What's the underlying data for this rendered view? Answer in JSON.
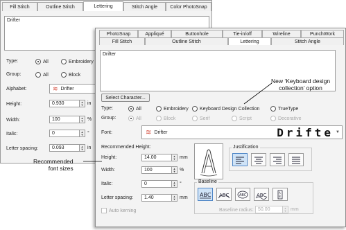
{
  "back_window": {
    "tabs": [
      "Fill Stitch",
      "Outline Stitch",
      "Lettering",
      "Stitch Angle",
      "Color PhotoSnap"
    ],
    "active_tab": "Lettering",
    "text_value": "Drifter",
    "type_label": "Type:",
    "type_options": [
      "All",
      "Embroidery"
    ],
    "group_label": "Group:",
    "group_options": [
      "All",
      "Block"
    ],
    "alphabet_label": "Alphabet:",
    "alphabet_value": "Drifter",
    "height_label": "Height:",
    "height_value": "0.930",
    "height_unit": "in",
    "width_label": "Width:",
    "width_value": "100",
    "width_unit": "%",
    "italic_label": "Italic:",
    "italic_value": "0",
    "italic_unit": "°",
    "spacing_label": "Letter spacing:",
    "spacing_value": "0.093",
    "spacing_unit": "in"
  },
  "front_window": {
    "tabs_row1": [
      "PhotoSnap",
      "Appliqué",
      "Buttonhole",
      "Tie-in/off",
      "Wireline",
      "PunchWork"
    ],
    "tabs_row2": [
      "Fill Stitch",
      "Outline Stitch",
      "Lettering",
      "Stitch Angle"
    ],
    "active_tab": "Lettering",
    "text_value": "Drifter",
    "select_character": "Select Character...",
    "type_label": "Type:",
    "type_options": [
      "All",
      "Embroidery",
      "Keyboard Design Collection",
      "TrueType"
    ],
    "group_label": "Group:",
    "group_options": [
      "All",
      "Block",
      "Serif",
      "Script",
      "Decorative"
    ],
    "font_label": "Font:",
    "font_value": "Drifter",
    "font_preview": "Drifte",
    "recommended_height": "Recommended Height:",
    "height_label": "Height:",
    "height_value": "14.00",
    "height_unit": "mm",
    "width_label": "Width:",
    "width_value": "100",
    "width_unit": "%",
    "italic_label": "Italic:",
    "italic_value": "0",
    "italic_unit": "°",
    "spacing_label": "Letter spacing:",
    "spacing_value": "1.40",
    "spacing_unit": "mm",
    "auto_kerning": "Auto kerning",
    "justification": "Justification",
    "baseline": "Baseline",
    "baseline_radius_label": "Baseline radius:",
    "baseline_radius_value": "50.00",
    "baseline_radius_unit": "mm"
  },
  "callouts": {
    "keyboard_line1": "New ‘Keyboard design",
    "keyboard_line2": "collection’ option",
    "recommended_line1": "Recommended",
    "recommended_line2": "font sizes"
  },
  "colors": {
    "selected_icon": "#cfe3f7",
    "alphabet_icon": "#d44a3a"
  }
}
